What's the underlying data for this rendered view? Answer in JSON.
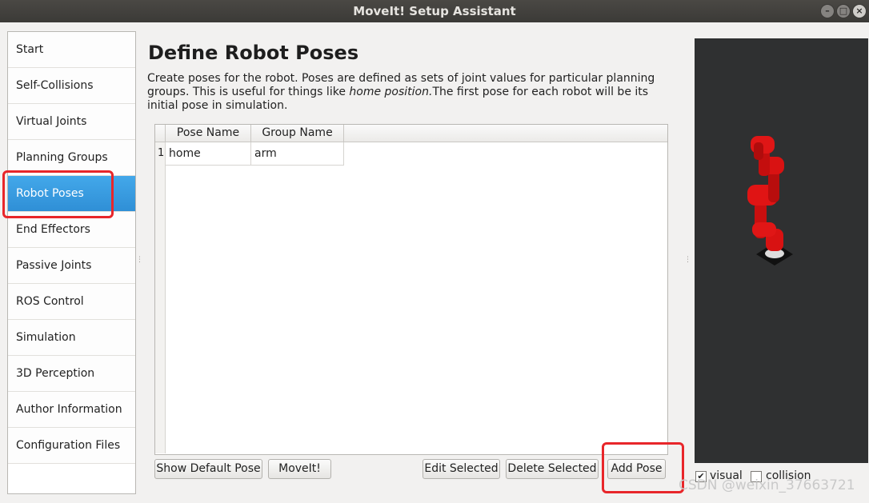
{
  "window": {
    "title": "MoveIt! Setup Assistant"
  },
  "sidebar": {
    "items": [
      {
        "label": "Start"
      },
      {
        "label": "Self-Collisions"
      },
      {
        "label": "Virtual Joints"
      },
      {
        "label": "Planning Groups"
      },
      {
        "label": "Robot Poses"
      },
      {
        "label": "End Effectors"
      },
      {
        "label": "Passive Joints"
      },
      {
        "label": "ROS Control"
      },
      {
        "label": "Simulation"
      },
      {
        "label": "3D Perception"
      },
      {
        "label": "Author Information"
      },
      {
        "label": "Configuration Files"
      }
    ],
    "active_index": 4
  },
  "main": {
    "title": "Define Robot Poses",
    "desc_1": "Create poses for the robot. Poses are defined as sets of joint values for particular planning groups. This is useful for things like ",
    "desc_em": "home position.",
    "desc_2": "The first pose for each robot will be its initial pose in simulation.",
    "table": {
      "columns": [
        "Pose Name",
        "Group Name"
      ],
      "rows": [
        {
          "num": "1",
          "pose": "home",
          "group": "arm"
        }
      ]
    },
    "buttons": {
      "show_default": "Show Default Pose",
      "moveit": "MoveIt!",
      "edit": "Edit Selected",
      "delete": "Delete Selected",
      "add": "Add Pose"
    }
  },
  "viewer": {
    "visual_label": "visual",
    "visual_checked": true,
    "collision_label": "collision",
    "collision_checked": false,
    "robot_color": "#e01010"
  },
  "watermark": "CSDN @weixin_37663721"
}
